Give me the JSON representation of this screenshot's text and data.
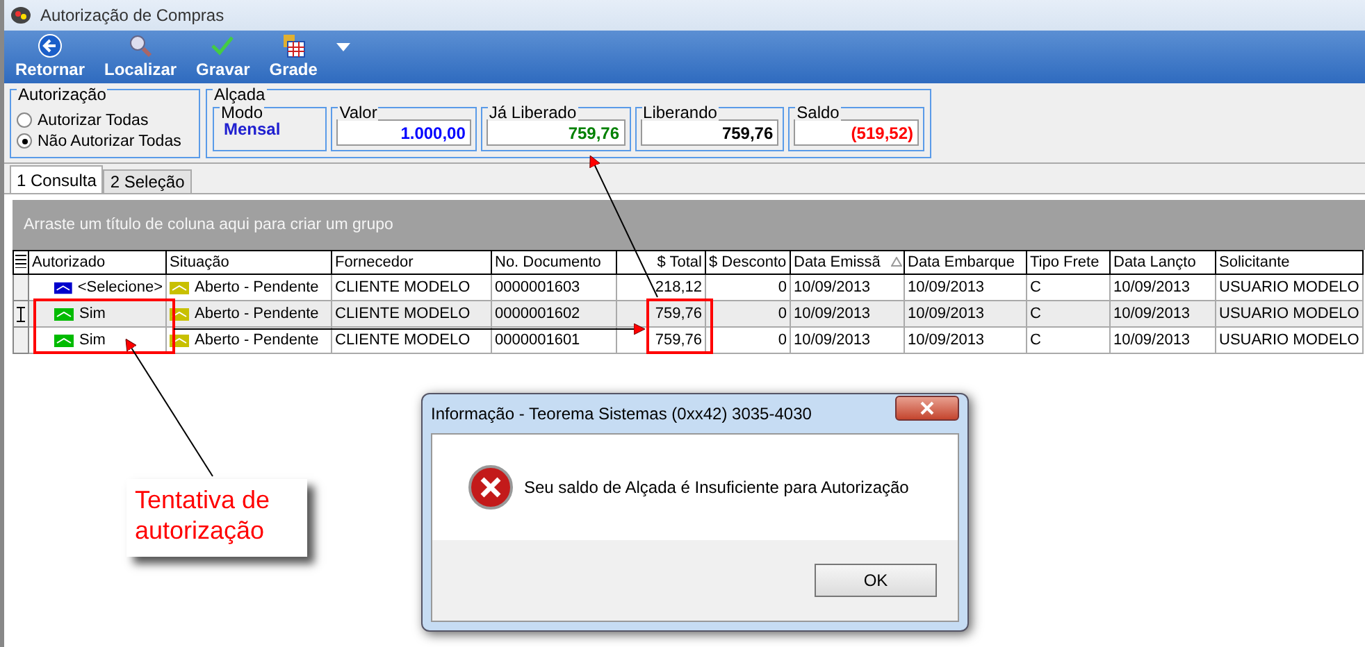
{
  "window": {
    "title": "Autorização de Compras"
  },
  "toolbar": [
    {
      "label": "Retornar",
      "kind": "back"
    },
    {
      "label": "Localizar",
      "kind": "search"
    },
    {
      "label": "Gravar",
      "kind": "check"
    },
    {
      "label": "Grade",
      "kind": "grid"
    }
  ],
  "authorization": {
    "title": "Autorização",
    "options": [
      {
        "label": "Autorizar Todas",
        "selected": false
      },
      {
        "label": "Não Autorizar Todas",
        "selected": true
      }
    ]
  },
  "alcada": {
    "title": "Alçada",
    "modo": {
      "label": "Modo",
      "value": "Mensal"
    },
    "fields": [
      {
        "label": "Valor",
        "value": "1.000,00",
        "color": "#0000ff"
      },
      {
        "label": "Já Liberado",
        "value": "759,76",
        "color": "#008000"
      },
      {
        "label": "Liberando",
        "value": "759,76",
        "color": "#000000"
      },
      {
        "label": "Saldo",
        "value": "(519,52)",
        "color": "#ff0000"
      }
    ]
  },
  "tabs": [
    {
      "label": "1 Consulta",
      "selected": true
    },
    {
      "label": "2 Seleção",
      "selected": false
    }
  ],
  "group_hint": "Arraste um título de coluna aqui para criar um grupo",
  "table": {
    "columns": [
      "Autorizado",
      "Situação",
      "Fornecedor",
      "No. Documento",
      "$ Total",
      "$ Desconto",
      "Data Emissã",
      "Data Embarque",
      "Tipo Frete",
      "Data Lançto",
      "Solicitante"
    ],
    "rows": [
      {
        "current": false,
        "color": "#0000cc",
        "cells": [
          "<Selecione>",
          "Aberto - Pendente",
          "CLIENTE MODELO",
          "0000001603",
          "218,12",
          "0",
          "10/09/2013",
          "10/09/2013",
          "C",
          "10/09/2013",
          "USUARIO MODELO"
        ]
      },
      {
        "current": true,
        "color": "#00bb00",
        "cells": [
          "Sim",
          "Aberto - Pendente",
          "CLIENTE MODELO",
          "0000001602",
          "759,76",
          "0",
          "10/09/2013",
          "10/09/2013",
          "C",
          "10/09/2013",
          "USUARIO MODELO"
        ]
      },
      {
        "current": false,
        "color": "#00bb00",
        "cells": [
          "Sim",
          "Aberto - Pendente",
          "CLIENTE MODELO",
          "0000001601",
          "759,76",
          "0",
          "10/09/2013",
          "10/09/2013",
          "C",
          "10/09/2013",
          "USUARIO MODELO"
        ]
      }
    ]
  },
  "callout": "Tentativa de autorização",
  "dialog": {
    "title": "Informação - Teorema Sistemas (0xx42) 3035-4030",
    "message": "Seu saldo de Alçada é Insuficiente para Autorização",
    "button": "OK"
  }
}
